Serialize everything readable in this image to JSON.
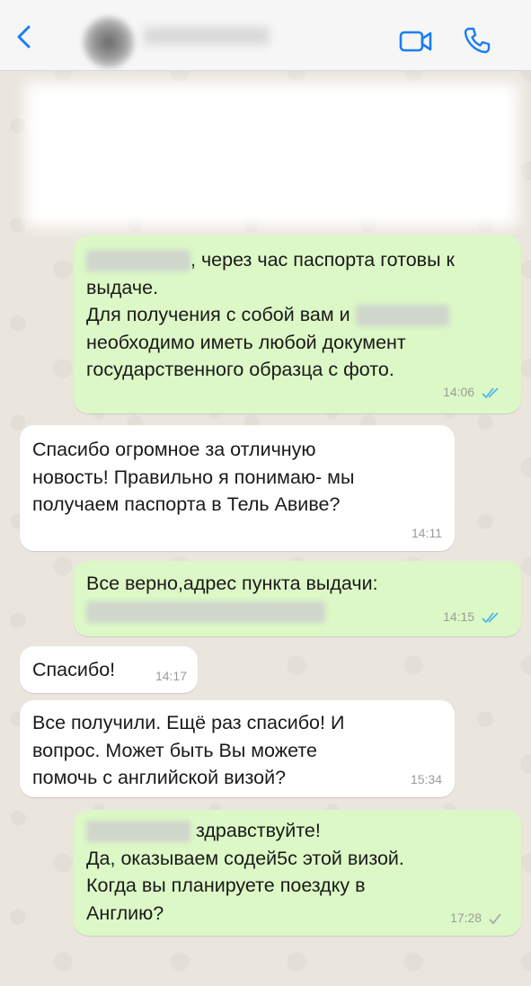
{
  "header": {
    "back_icon": "chevron-left-icon",
    "video_icon": "video-camera-icon",
    "call_icon": "phone-icon",
    "accent_color": "#1a7ef2"
  },
  "messages": [
    {
      "id": "m1",
      "direction": "outgoing",
      "lines": [
        ", через час паспорта готовы к",
        "выдаче.",
        "Для получения с собой вам и",
        "необходимо иметь любой документ",
        "государственного образца с фото."
      ],
      "time": "14:06",
      "status": "read"
    },
    {
      "id": "m2",
      "direction": "incoming",
      "lines": [
        "Спасибо огромное за отличную",
        "новость! Правильно я понимаю- мы",
        "получаем паспорта в Тель Авиве?"
      ],
      "time": "14:11"
    },
    {
      "id": "m3",
      "direction": "outgoing",
      "lines": [
        "Все верно,адрес пункта выдачи:"
      ],
      "time": "14:15",
      "status": "read"
    },
    {
      "id": "m4",
      "direction": "incoming",
      "lines": [
        "Спасибо!"
      ],
      "time": "14:17"
    },
    {
      "id": "m5",
      "direction": "incoming",
      "lines": [
        "Все получили. Ещё раз спасибо! И",
        "вопрос. Может быть Вы можете",
        "помочь с английской визой?"
      ],
      "time": "15:34"
    },
    {
      "id": "m6",
      "direction": "outgoing",
      "lines": [
        "здравствуйте!",
        "Да, оказываем содей5с этой визой.",
        "Когда вы планируете поездку в",
        "Англию?"
      ],
      "time": "17:28",
      "status": "delivered"
    }
  ],
  "colors": {
    "outgoing_bubble": "#dcf8c6",
    "incoming_bubble": "#ffffff",
    "read_ticks": "#4fb6ec",
    "delivered_tick": "#a8a8a8"
  }
}
